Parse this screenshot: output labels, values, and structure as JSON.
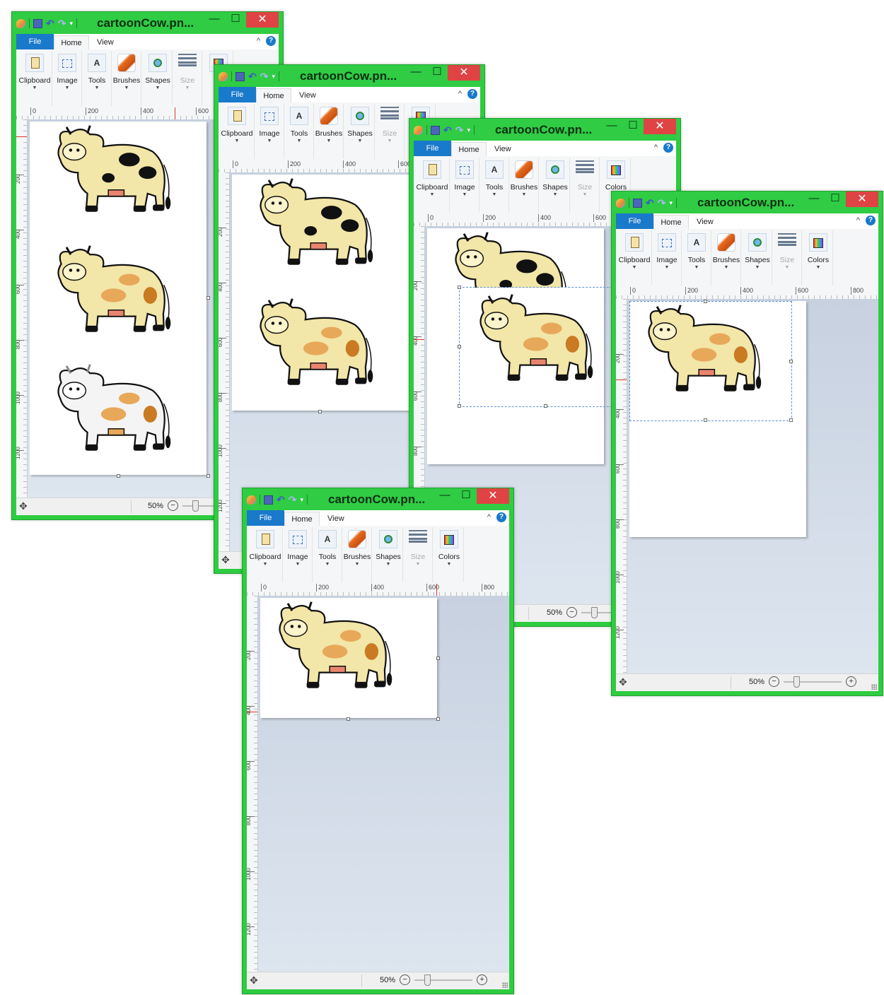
{
  "title": "cartoonCow.pn...",
  "tabs": {
    "file": "File",
    "home": "Home",
    "view": "View"
  },
  "ribbon": {
    "clipboard": "Clipboard",
    "image": "Image",
    "tools": "Tools",
    "brushes": "Brushes",
    "shapes": "Shapes",
    "size": "Size",
    "colors": "Colors"
  },
  "help": "?",
  "ruler_h": {
    "t0": "0",
    "t200": "200",
    "t400": "400",
    "t600": "600",
    "t800": "800"
  },
  "ruler_v": {
    "t200": "200",
    "t400": "400",
    "t600": "600",
    "t800": "800",
    "t1000": "1000",
    "t1200": "1200"
  },
  "status": {
    "zoom": "50%",
    "minus": "−",
    "plus": "+"
  },
  "icons": {
    "app": "paint-icon",
    "save": "save-icon",
    "undo": "undo-icon",
    "redo": "redo-icon",
    "move": "move-icon"
  },
  "colors": {
    "frame": "#2ecc40",
    "close": "#e04343",
    "file_tab": "#1979ca",
    "spots_black": "#111111",
    "spots_brown": "#e8a85a",
    "body": "#f2e6a8"
  }
}
